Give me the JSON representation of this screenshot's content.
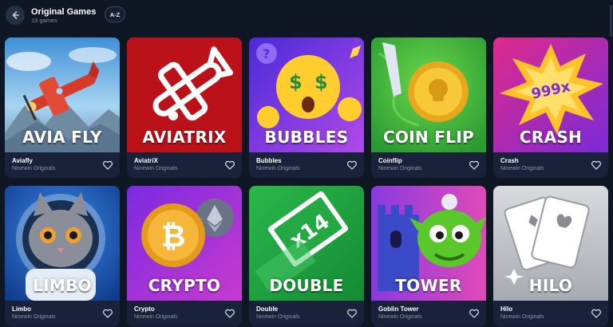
{
  "header": {
    "title": "Original Games",
    "count": "19 games",
    "sort_label": "A-Z"
  },
  "games": [
    {
      "art": "AVIA FLY",
      "name": "Aviafly",
      "provider": "Ninewin Originals",
      "bg": "#5ea8e0",
      "icon": "plane-icon"
    },
    {
      "art": "AVIATRIX",
      "name": "AviatriX",
      "provider": "Ninewin Originals",
      "bg": "#c8141c",
      "icon": "plane-icon"
    },
    {
      "art": "BUBBLES",
      "name": "Bubbles",
      "provider": "Ninewin Originals",
      "bg": "#7a3ee0",
      "icon": "emoji-icon"
    },
    {
      "art": "COIN FLIP",
      "name": "Coinflip",
      "provider": "Ninewin Originals",
      "bg": "#3cbc3c",
      "icon": "coin-icon"
    },
    {
      "art": "CRASH",
      "name": "Crash",
      "provider": "Ninewin Originals",
      "bg": "#b02ec8",
      "icon": "explosion-icon"
    },
    {
      "art": "LIMBO",
      "name": "Limbo",
      "provider": "Ninewin Originals",
      "bg": "#1e62c0",
      "icon": "cat-icon"
    },
    {
      "art": "CRYPTO",
      "name": "Crypto",
      "provider": "Ninewin Originals",
      "bg": "#9b2fd8",
      "icon": "bitcoin-icon"
    },
    {
      "art": "DOUBLE",
      "name": "Double",
      "provider": "Ninewin Originals",
      "bg": "#22b04a",
      "icon": "ticket-icon"
    },
    {
      "art": "TOWER",
      "name": "Goblin Tower",
      "provider": "Ninewin Originals",
      "bg": "#c83ac8",
      "icon": "goblin-icon"
    },
    {
      "art": "HILO",
      "name": "Hilo",
      "provider": "Ninewin Originals",
      "bg": "#c4c6cc",
      "icon": "cards-icon"
    }
  ],
  "extra_art": {
    "crash_multiplier": "999x",
    "double_multiplier": "x14"
  }
}
